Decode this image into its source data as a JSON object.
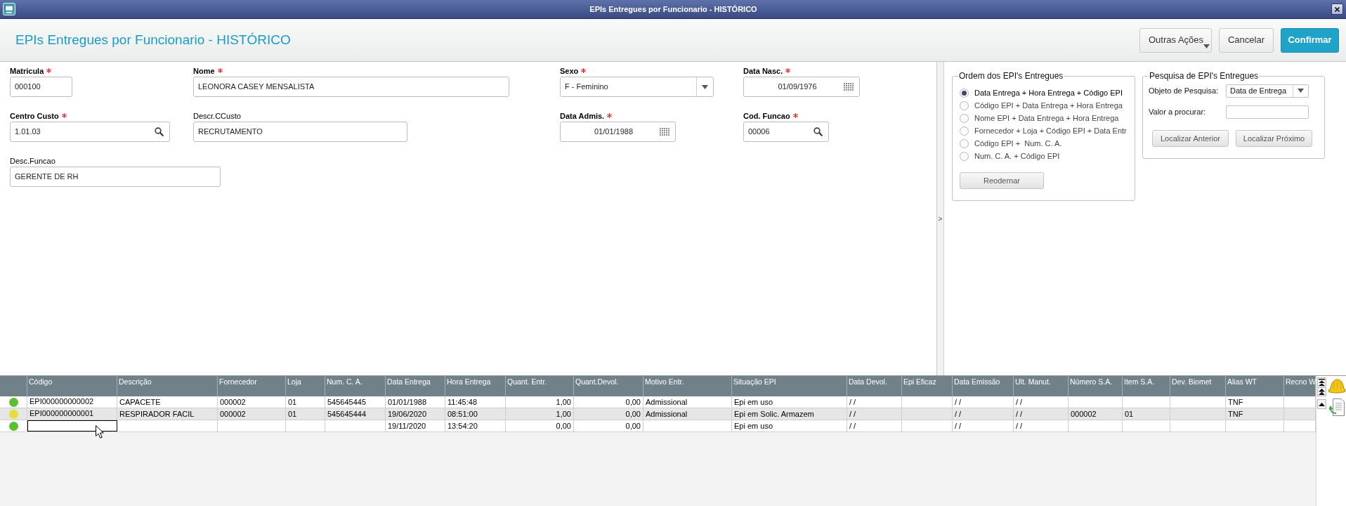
{
  "window": {
    "title": "EPIs Entregues por Funcionario - HISTÓRICO"
  },
  "header": {
    "title": "EPIs Entregues por Funcionario - HISTÓRICO",
    "buttons": [
      {
        "label": "Outras Ações",
        "kind": "menu"
      },
      {
        "label": "Cancelar",
        "kind": "secondary"
      },
      {
        "label": "Confirmar",
        "kind": "primary"
      }
    ]
  },
  "form": {
    "rows": [
      [
        {
          "label": "Matricula",
          "required": true,
          "kind": "text",
          "value": "000100"
        },
        {
          "label": "Nome",
          "required": true,
          "kind": "text",
          "value": "LEONORA CASEY MENSALISTA"
        },
        {
          "label": "Sexo",
          "required": true,
          "kind": "select",
          "value": "F - Feminino"
        },
        {
          "label": "Data Nasc.",
          "required": true,
          "kind": "date",
          "value": "01/09/1976"
        }
      ],
      [
        {
          "label": "Centro Custo",
          "required": true,
          "kind": "lookup",
          "value": "1.01.03"
        },
        {
          "label": "Descr.CCusto",
          "required": false,
          "kind": "text",
          "value": "RECRUTAMENTO"
        },
        {
          "label": "Data Admis.",
          "required": true,
          "kind": "date",
          "value": "01/01/1988"
        },
        {
          "label": "Cod. Funcao",
          "required": true,
          "kind": "lookup",
          "value": "00006"
        }
      ],
      [
        {
          "label": "Desc.Funcao",
          "required": false,
          "kind": "text",
          "value": "GERENTE DE RH"
        }
      ]
    ]
  },
  "splitter": {
    "label": ">"
  },
  "order_group": {
    "title": "Ordem dos EPI's Entregues",
    "options": [
      {
        "label": "Data Entrega + Hora Entrega + Código EPI",
        "selected": true
      },
      {
        "label": "Código EPI + Data Entrega + Hora Entrega",
        "selected": false
      },
      {
        "label": "Nome EPI + Data Entrega + Hora Entrega",
        "selected": false
      },
      {
        "label": "Fornecedor + Loja + Código EPI + Data Entr",
        "selected": false
      },
      {
        "label": "Código EPI +  Num. C. A.",
        "selected": false
      },
      {
        "label": "Num. C. A. + Código EPI",
        "selected": false
      }
    ],
    "button": "Reodernar"
  },
  "search_group": {
    "title": "Pesquisa de EPI's Entregues",
    "search_object": {
      "label": "Objeto de Pesquisa:",
      "value": "Data de Entrega"
    },
    "search_value": {
      "label": "Valor a procurar:"
    },
    "buttons": [
      "Localizar Anterior",
      "Localizar Próximo"
    ]
  },
  "table": {
    "columns": [
      {
        "label": "Código",
        "kind": "text"
      },
      {
        "label": "Descrição",
        "kind": "text"
      },
      {
        "label": "Fornecedor",
        "kind": "text"
      },
      {
        "label": "Loja",
        "kind": "text"
      },
      {
        "label": "Num. C. A.",
        "kind": "text"
      },
      {
        "label": "Data Entrega",
        "kind": "text"
      },
      {
        "label": "Hora Entrega",
        "kind": "text"
      },
      {
        "label": "Quant. Entr.",
        "kind": "number"
      },
      {
        "label": "Quant.Devol.",
        "kind": "number"
      },
      {
        "label": "Motivo Entr.",
        "kind": "text"
      },
      {
        "label": "Situação EPI",
        "kind": "text"
      },
      {
        "label": "Data Devol.",
        "kind": "text"
      },
      {
        "label": "Epi Eficaz",
        "kind": "text"
      },
      {
        "label": "Data Emissão",
        "kind": "text"
      },
      {
        "label": "Ult. Manut.",
        "kind": "text"
      },
      {
        "label": "Número S.A.",
        "kind": "text"
      },
      {
        "label": "Item S.A.",
        "kind": "text"
      },
      {
        "label": "Dev. Biomet",
        "kind": "text"
      },
      {
        "label": "Alias WT",
        "kind": "text"
      },
      {
        "label": "Recno W",
        "kind": "text"
      }
    ],
    "rows": [
      {
        "color": "#5cbf2e",
        "selected": false,
        "cells": [
          "EPI000000000002",
          "CAPACETE",
          "000002",
          "01",
          "545645445",
          "01/01/1988",
          "11:45:48",
          "1,00",
          "0,00",
          "Admissional",
          "Epi em uso",
          "/ /",
          null,
          "/ /",
          "/ /",
          null,
          null,
          null,
          "TNF",
          null
        ]
      },
      {
        "color": "#e4de38",
        "selected": false,
        "cells": [
          "EPI000000000001",
          "RESPIRADOR FACIL",
          "000002",
          "01",
          "545645444",
          "19/06/2020",
          "08:51:00",
          "1,00",
          "0,00",
          "Admissional",
          "Epi em Solic. Armazem",
          "/ /",
          null,
          "/ /",
          "/ /",
          "000002",
          "01",
          null,
          "TNF",
          null
        ]
      },
      {
        "color": "#5cbf2e",
        "selected": true,
        "cells": [
          null,
          null,
          null,
          null,
          null,
          "19/11/2020",
          "13:54:20",
          "0,00",
          "0,00",
          null,
          "Epi em uso",
          "/ /",
          null,
          "/ /",
          "/ /",
          null,
          null,
          null,
          null,
          null
        ]
      }
    ]
  }
}
